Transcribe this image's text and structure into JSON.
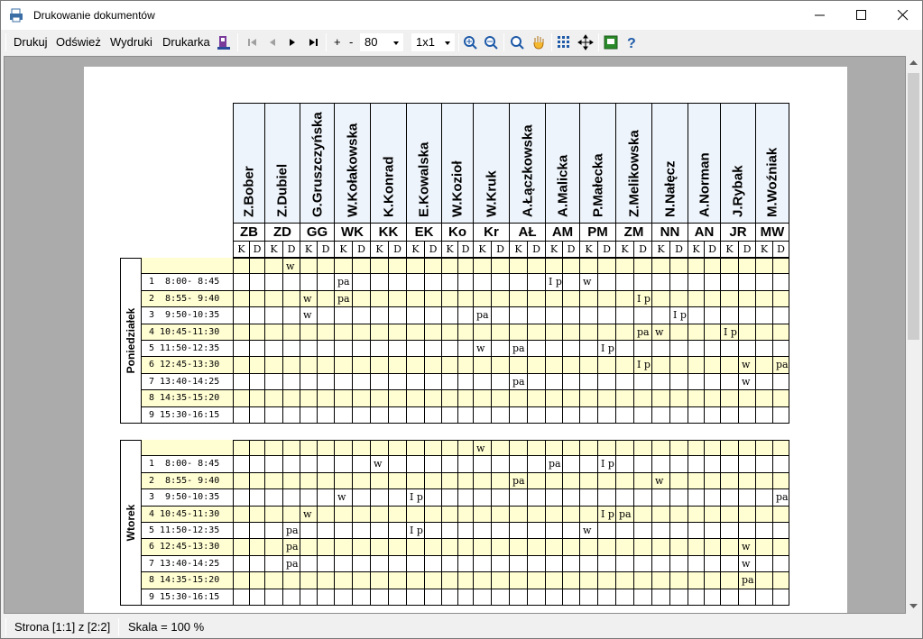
{
  "window": {
    "title": "Drukowanie dokumentów"
  },
  "toolbar": {
    "print": "Drukuj",
    "refresh": "Odśwież",
    "prints": "Wydruki",
    "printer": "Drukarka",
    "zoom_plus": "+",
    "zoom_minus": "-",
    "zoom_value": "80",
    "layout_value": "1x1"
  },
  "status": {
    "page": "Strona [1:1] z [2:2]",
    "scale": "Skala = 100 %"
  },
  "teachers": [
    {
      "name": "Z.Bober",
      "code": "ZB"
    },
    {
      "name": "Z.Dubiel",
      "code": "ZD"
    },
    {
      "name": "G.Gruszczyńska",
      "code": "GG"
    },
    {
      "name": "W.Kołakowska",
      "code": "WK"
    },
    {
      "name": "K.Konrad",
      "code": "KK"
    },
    {
      "name": "E.Kowalska",
      "code": "EK"
    },
    {
      "name": "W.Kozioł",
      "code": "Ko"
    },
    {
      "name": "W.Kruk",
      "code": "Kr"
    },
    {
      "name": "A.Łączkowska",
      "code": "AŁ"
    },
    {
      "name": "A.Malicka",
      "code": "AM"
    },
    {
      "name": "P.Małecka",
      "code": "PM"
    },
    {
      "name": "Z.Melikowska",
      "code": "ZM"
    },
    {
      "name": "N.Nałęcz",
      "code": "NN"
    },
    {
      "name": "A.Norman",
      "code": "AN"
    },
    {
      "name": "J.Rybak",
      "code": "JR"
    },
    {
      "name": "M.Woźniak",
      "code": "MW"
    }
  ],
  "kd": {
    "k": "K",
    "d": "D"
  },
  "days": [
    {
      "name": "Poniedziałek",
      "rows": [
        {
          "time": "",
          "cells": {
            "3": "w"
          }
        },
        {
          "time": "1  8:00- 8:45",
          "cells": {
            "6": "pa",
            "18": "I p",
            "20": "w"
          }
        },
        {
          "time": "2  8:55- 9:40",
          "cells": {
            "4": "w",
            "6": "pa",
            "23": "I p"
          }
        },
        {
          "time": "3  9:50-10:35",
          "cells": {
            "4": "w",
            "14": "pa",
            "25": "I p"
          }
        },
        {
          "time": "4 10:45-11:30",
          "cells": {
            "23": "pa",
            "24": "w",
            "28": "I p"
          }
        },
        {
          "time": "5 11:50-12:35",
          "cells": {
            "14": "w",
            "16": "pa",
            "21": "I p"
          }
        },
        {
          "time": "6 12:45-13:30",
          "cells": {
            "23": "I p",
            "29": "w",
            "31": "pa"
          }
        },
        {
          "time": "7 13:40-14:25",
          "cells": {
            "16": "pa",
            "29": "w"
          }
        },
        {
          "time": "8 14:35-15:20",
          "cells": {}
        },
        {
          "time": "9 15:30-16:15",
          "cells": {}
        }
      ]
    },
    {
      "name": "Wtorek",
      "rows": [
        {
          "time": "",
          "cells": {
            "14": "w"
          }
        },
        {
          "time": "1  8:00- 8:45",
          "cells": {
            "8": "w",
            "18": "pa",
            "21": "I p"
          }
        },
        {
          "time": "2  8:55- 9:40",
          "cells": {
            "16": "pa",
            "24": "w"
          }
        },
        {
          "time": "3  9:50-10:35",
          "cells": {
            "6": "w",
            "10": "I p",
            "31": "pa"
          }
        },
        {
          "time": "4 10:45-11:30",
          "cells": {
            "4": "w",
            "21": "I p",
            "22": "pa"
          }
        },
        {
          "time": "5 11:50-12:35",
          "cells": {
            "3": "pa",
            "10": "I p",
            "20": "w"
          }
        },
        {
          "time": "6 12:45-13:30",
          "cells": {
            "3": "pa",
            "29": "w"
          }
        },
        {
          "time": "7 13:40-14:25",
          "cells": {
            "3": "pa",
            "29": "w"
          }
        },
        {
          "time": "8 14:35-15:20",
          "cells": {
            "29": "pa"
          }
        },
        {
          "time": "9 15:30-16:15",
          "cells": {}
        }
      ]
    }
  ],
  "colors": {
    "yellow_row": "#fffdd2",
    "header_bg": "#eef4fb"
  }
}
